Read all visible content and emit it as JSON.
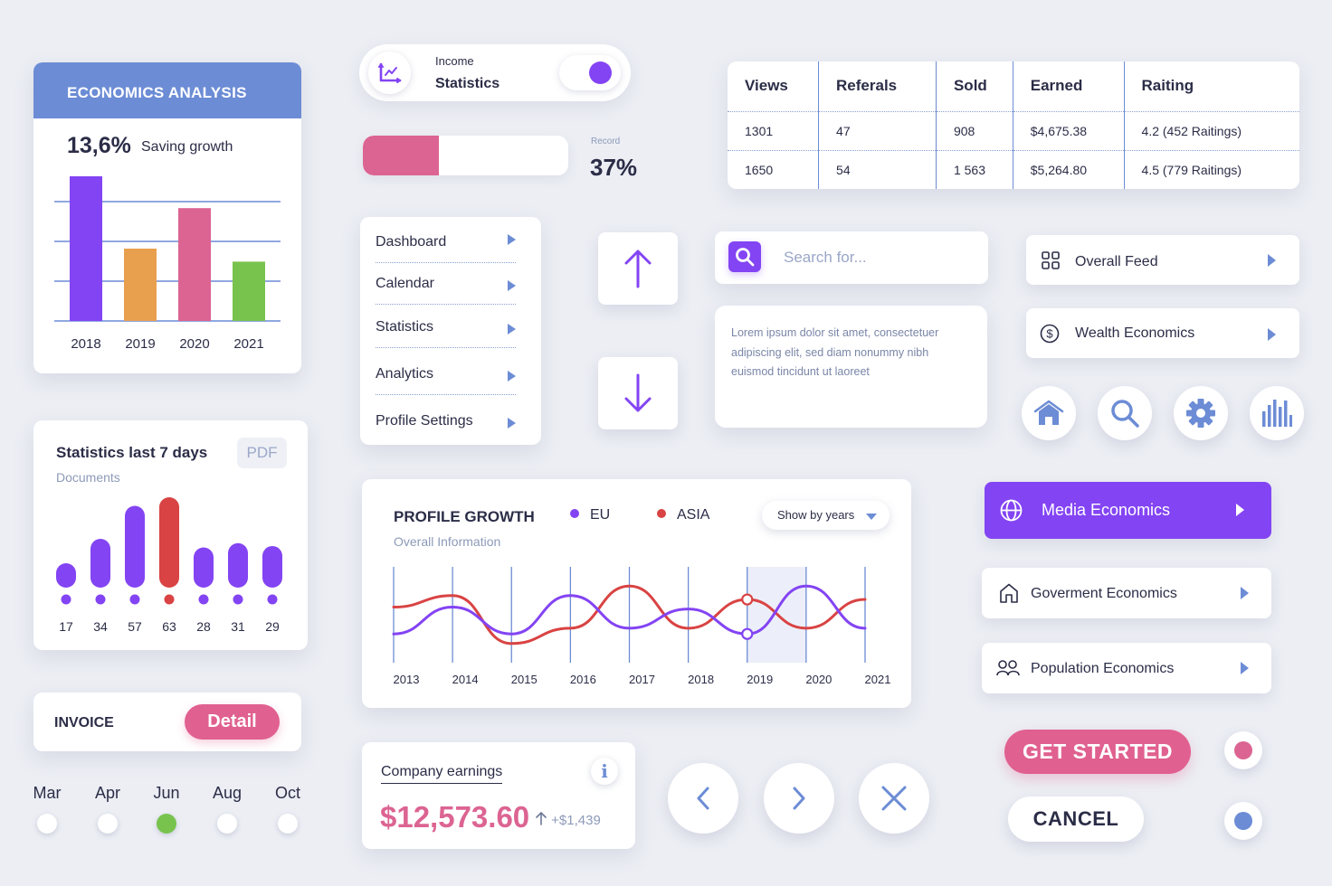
{
  "colors": {
    "purple": "#8344f3",
    "pink": "#dc6492",
    "red": "#d94343",
    "blue": "#6c8cd5",
    "orange": "#e8a04e",
    "green": "#78c34e",
    "dark": "#2b2d47"
  },
  "economics": {
    "title": "ECONOMICS ANALYSIS",
    "metric_value": "13,6%",
    "metric_label": "Saving growth"
  },
  "stats7": {
    "title": "Statistics last 7 days",
    "subtitle": "Documents",
    "pdf_label": "PDF"
  },
  "invoice": {
    "label": "INVOICE",
    "button_label": "Detail"
  },
  "months": {
    "items": [
      "Mar",
      "Apr",
      "Jun",
      "Aug",
      "Oct"
    ],
    "selected": "Jun"
  },
  "income": {
    "line1": "Income",
    "line2": "Statistics",
    "toggle_on": true
  },
  "record": {
    "label": "Record",
    "value_text": "37%",
    "progress_fraction": 0.37
  },
  "table": {
    "headers": [
      "Views",
      "Referals",
      "Sold",
      "Earned",
      "Raiting"
    ],
    "rows": [
      [
        "1301",
        "47",
        "908",
        "$4,675.38",
        "4.2 (452 Raitings)"
      ],
      [
        "1650",
        "54",
        "1 563",
        "$5,264.80",
        "4.5 (779 Raitings)"
      ]
    ]
  },
  "menu": {
    "items": [
      "Dashboard",
      "Calendar",
      "Statistics",
      "Analytics",
      "Profile Settings"
    ]
  },
  "arrows": {
    "up": "arrow-up",
    "down": "arrow-down"
  },
  "search": {
    "placeholder": "Search for...",
    "value": ""
  },
  "lorem": {
    "text": "Lorem ipsum dolor sit amet, consectetuer adipiscing elit, sed diam nonummy nibh euismod tincidunt ut laoreet"
  },
  "right_list": {
    "overall_feed": "Overall Feed",
    "wealth": "Wealth Economics",
    "media": "Media Economics",
    "government": "Goverment Economics",
    "population": "Population Economics"
  },
  "icon_buttons": [
    "home-icon",
    "search-icon",
    "gear-icon",
    "bar-chart-icon"
  ],
  "growth": {
    "title": "PROFILE GROWTH",
    "subtitle": "Overall Information",
    "select_value": "Show by years"
  },
  "earnings": {
    "title": "Company earnings",
    "amount": "$12,573.60",
    "delta": "+$1,439",
    "info_label": "i"
  },
  "buttons": {
    "get_started": "GET STARTED",
    "cancel": "CANCEL"
  },
  "chart_data": [
    {
      "type": "bar",
      "title": "ECONOMICS ANALYSIS",
      "categories": [
        "2018",
        "2019",
        "2020",
        "2021"
      ],
      "values": [
        100,
        50,
        78,
        41
      ],
      "colors": [
        "#8344f3",
        "#e8a04e",
        "#dc6492",
        "#78c34e"
      ],
      "ylim": [
        0,
        100
      ],
      "grid": true,
      "xlabel": "",
      "ylabel": ""
    },
    {
      "type": "bar",
      "title": "Statistics last 7 days",
      "categories": [
        "17",
        "34",
        "57",
        "63",
        "28",
        "31",
        "29"
      ],
      "values": [
        17,
        34,
        57,
        63,
        28,
        31,
        29
      ],
      "highlight_index": 3,
      "ylim": [
        0,
        63
      ],
      "grid": false
    },
    {
      "type": "line",
      "title": "PROFILE GROWTH",
      "x": [
        "2013",
        "2014",
        "2015",
        "2016",
        "2017",
        "2018",
        "2019",
        "2020",
        "2021"
      ],
      "series": [
        {
          "name": "EU",
          "color": "#8344f3",
          "values": [
            30,
            58,
            30,
            70,
            36,
            56,
            30,
            80,
            36
          ]
        },
        {
          "name": "ASIA",
          "color": "#d94343",
          "values": [
            58,
            70,
            20,
            36,
            80,
            36,
            66,
            36,
            66
          ]
        }
      ],
      "ylim": [
        0,
        100
      ],
      "highlight_range": [
        "2019",
        "2020"
      ],
      "marked_x": "2019",
      "legend": "top",
      "grid": "vertical"
    }
  ]
}
